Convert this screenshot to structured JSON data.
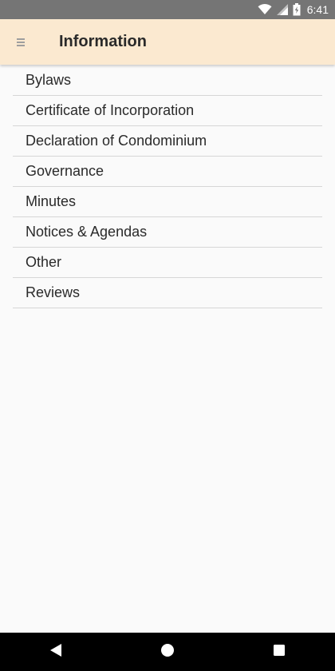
{
  "status_bar": {
    "time": "6:41",
    "icons": [
      "wifi-icon",
      "signal-icon",
      "battery-icon"
    ]
  },
  "app_bar": {
    "title": "Information",
    "menu_icon": "menu-icon",
    "background_color": "#fbe9d0"
  },
  "list": {
    "items": [
      {
        "label": "Bylaws"
      },
      {
        "label": "Certificate of Incorporation"
      },
      {
        "label": "Declaration of Condominium"
      },
      {
        "label": "Governance"
      },
      {
        "label": "Minutes"
      },
      {
        "label": "Notices & Agendas"
      },
      {
        "label": "Other"
      },
      {
        "label": "Reviews"
      }
    ]
  },
  "nav_bar": {
    "buttons": [
      "back-icon",
      "home-icon",
      "recents-icon"
    ]
  }
}
